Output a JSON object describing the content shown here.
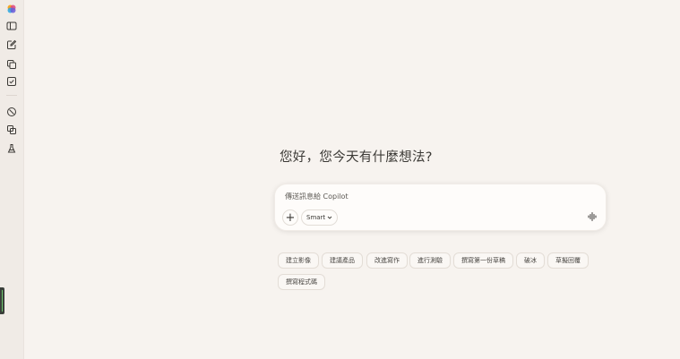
{
  "sidebar": {
    "items": [
      {
        "icon": "copilot-logo-icon"
      },
      {
        "icon": "sidebar-toggle-icon"
      },
      {
        "icon": "new-chat-icon"
      },
      {
        "icon": "copy-pages-icon"
      },
      {
        "icon": "checkbox-icon"
      },
      {
        "icon": "discover-icon"
      },
      {
        "icon": "library-icon"
      },
      {
        "icon": "labs-icon"
      }
    ]
  },
  "main": {
    "greeting": "您好，您今天有什麼想法?",
    "composer": {
      "placeholder": "傳送訊息給 Copilot",
      "mode_label": "Smart"
    },
    "suggestions": [
      "建立影像",
      "建議產品",
      "改進寫作",
      "進行測驗",
      "撰寫第一份草稿",
      "破冰",
      "草擬回覆",
      "撰寫程式碼"
    ]
  },
  "colors": {
    "background": "#f7f3ef",
    "sidebar": "#f0ebe6",
    "composer": "#fefcfa",
    "text": "#3b3935"
  }
}
